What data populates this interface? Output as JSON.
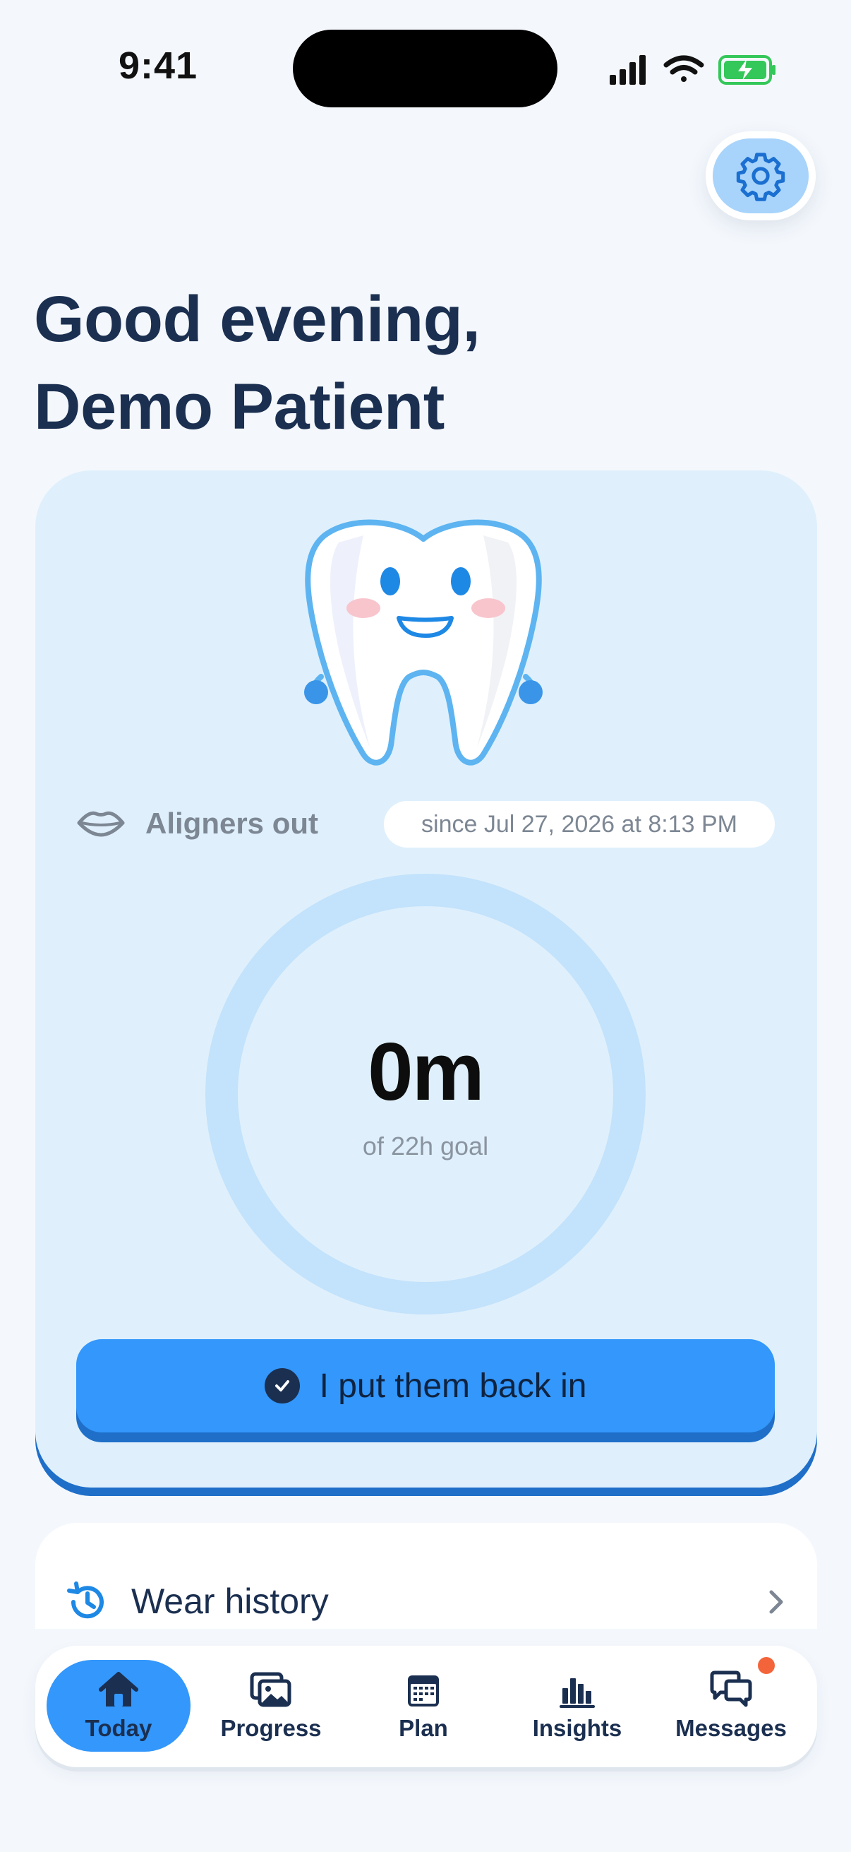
{
  "status_bar": {
    "time": "9:41"
  },
  "greeting": {
    "line1": "Good evening,",
    "line2": "Demo Patient"
  },
  "aligner_status": {
    "label": "Aligners out",
    "since": "since Jul 27, 2026 at 8:13 PM",
    "elapsed": "0m",
    "goal": "of 22h goal",
    "progress_fraction": 0
  },
  "action_button": {
    "label": "I put them back in"
  },
  "wear_history": {
    "label": "Wear history"
  },
  "tabs": [
    {
      "label": "Today",
      "icon": "home-icon",
      "active": true
    },
    {
      "label": "Progress",
      "icon": "photos-icon",
      "active": false
    },
    {
      "label": "Plan",
      "icon": "calendar-icon",
      "active": false
    },
    {
      "label": "Insights",
      "icon": "bar-chart-icon",
      "active": false
    },
    {
      "label": "Messages",
      "icon": "chat-bubbles-icon",
      "active": false,
      "badge": true
    }
  ],
  "colors": {
    "accent": "#3397fb",
    "card_bg": "#dff0fc",
    "ring_track": "#c3e2fb",
    "badge": "#f4643a",
    "heading": "#1b2f50"
  }
}
